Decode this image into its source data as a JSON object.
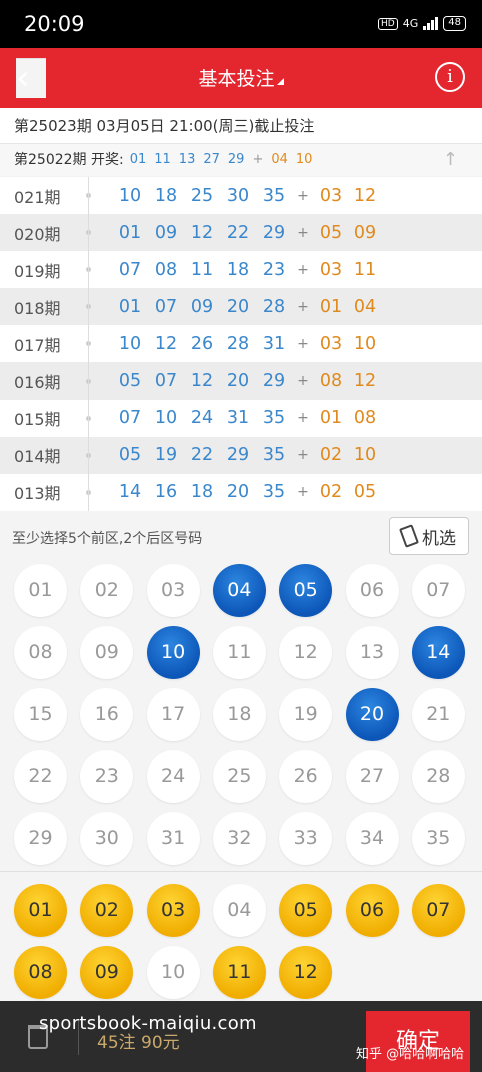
{
  "status_bar": {
    "time": "20:09",
    "network": "4G",
    "hd": "HD",
    "battery": "48"
  },
  "header": {
    "title": "基本投注"
  },
  "issue": {
    "text": "第25023期  03月05日 21:00(周三)截止投注"
  },
  "last_draw": {
    "label": "第25022期 开奖:",
    "front": [
      "01",
      "11",
      "13",
      "27",
      "29"
    ],
    "plus": "+",
    "back": [
      "04",
      "10"
    ]
  },
  "history": [
    {
      "period": "021期",
      "front": [
        "10",
        "18",
        "25",
        "30",
        "35"
      ],
      "back": [
        "03",
        "12"
      ]
    },
    {
      "period": "020期",
      "front": [
        "01",
        "09",
        "12",
        "22",
        "29"
      ],
      "back": [
        "05",
        "09"
      ]
    },
    {
      "period": "019期",
      "front": [
        "07",
        "08",
        "11",
        "18",
        "23"
      ],
      "back": [
        "03",
        "11"
      ]
    },
    {
      "period": "018期",
      "front": [
        "01",
        "07",
        "09",
        "20",
        "28"
      ],
      "back": [
        "01",
        "04"
      ]
    },
    {
      "period": "017期",
      "front": [
        "10",
        "12",
        "26",
        "28",
        "31"
      ],
      "back": [
        "03",
        "10"
      ]
    },
    {
      "period": "016期",
      "front": [
        "05",
        "07",
        "12",
        "20",
        "29"
      ],
      "back": [
        "08",
        "12"
      ]
    },
    {
      "period": "015期",
      "front": [
        "07",
        "10",
        "24",
        "31",
        "35"
      ],
      "back": [
        "01",
        "08"
      ]
    },
    {
      "period": "014期",
      "front": [
        "05",
        "19",
        "22",
        "29",
        "35"
      ],
      "back": [
        "02",
        "10"
      ]
    },
    {
      "period": "013期",
      "front": [
        "14",
        "16",
        "18",
        "20",
        "35"
      ],
      "back": [
        "02",
        "05"
      ]
    }
  ],
  "hint": {
    "text": "至少选择5个前区,2个后区号码",
    "random_label": "机选"
  },
  "front_balls": [
    "01",
    "02",
    "03",
    "04",
    "05",
    "06",
    "07",
    "08",
    "09",
    "10",
    "11",
    "12",
    "13",
    "14",
    "15",
    "16",
    "17",
    "18",
    "19",
    "20",
    "21",
    "22",
    "23",
    "24",
    "25",
    "26",
    "27",
    "28",
    "29",
    "30",
    "31",
    "32",
    "33",
    "34",
    "35"
  ],
  "front_selected": [
    "04",
    "05",
    "10",
    "14",
    "20"
  ],
  "back_balls": [
    "01",
    "02",
    "03",
    "04",
    "05",
    "06",
    "07",
    "08",
    "09",
    "10",
    "11",
    "12"
  ],
  "back_selected": [
    "01",
    "02",
    "03",
    "05",
    "06",
    "07",
    "08",
    "09",
    "11",
    "12"
  ],
  "footer": {
    "count": "45注  90元",
    "confirm": "确定"
  },
  "watermark": "sportsbook-maiqiu.com",
  "zhihu_mark": "知乎 @哈哈啊哈哈",
  "colors": {
    "brand_red": "#e4262f",
    "front_blue": "#0c56b8",
    "back_yellow": "#f0ad00",
    "history_blue": "#3a87cc",
    "history_orange": "#e08a1e"
  }
}
